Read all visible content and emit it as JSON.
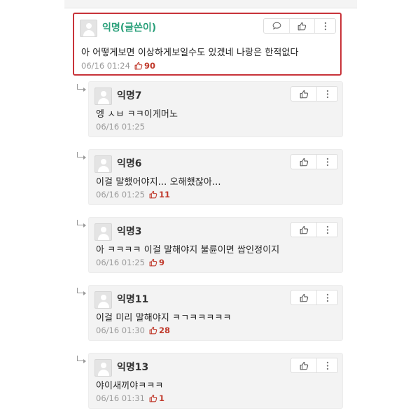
{
  "icons": {
    "comment": "speech-bubble-icon",
    "like": "thumbs-up-icon",
    "more": "kebab-menu-icon",
    "reply": "reply-arrow-icon",
    "avatar": "default-avatar"
  },
  "colors": {
    "highlight_border": "#c8333a",
    "op_nick": "#2aa07a",
    "like_count": "#c0392b"
  },
  "main_comment": {
    "nickname": "익명(글쓴이)",
    "text": "아 어떻게보면 이상하게보일수도 있겠네 나랑은 한적없다",
    "time": "06/16 01:24",
    "likes": "90"
  },
  "replies": [
    {
      "nickname": "익명7",
      "text": "엥 ㅅㅂ ㅋㅋ이게머노",
      "time": "06/16 01:25",
      "likes": ""
    },
    {
      "nickname": "익명6",
      "text": "이걸 말했어야지... 오해했잖아...",
      "time": "06/16 01:25",
      "likes": "11"
    },
    {
      "nickname": "익명3",
      "text": "아 ㅋㅋㅋㅋ 이걸 말해야지 불륜이면 쌉인정이지",
      "time": "06/16 01:25",
      "likes": "9"
    },
    {
      "nickname": "익명11",
      "text": "이걸 미리 말해야지 ㅋㄱㅋㅋㅋㅋㅋ",
      "time": "06/16 01:30",
      "likes": "28"
    },
    {
      "nickname": "익명13",
      "text": "야이새끼야ㅋㅋㅋ",
      "time": "06/16 01:31",
      "likes": "1"
    }
  ]
}
